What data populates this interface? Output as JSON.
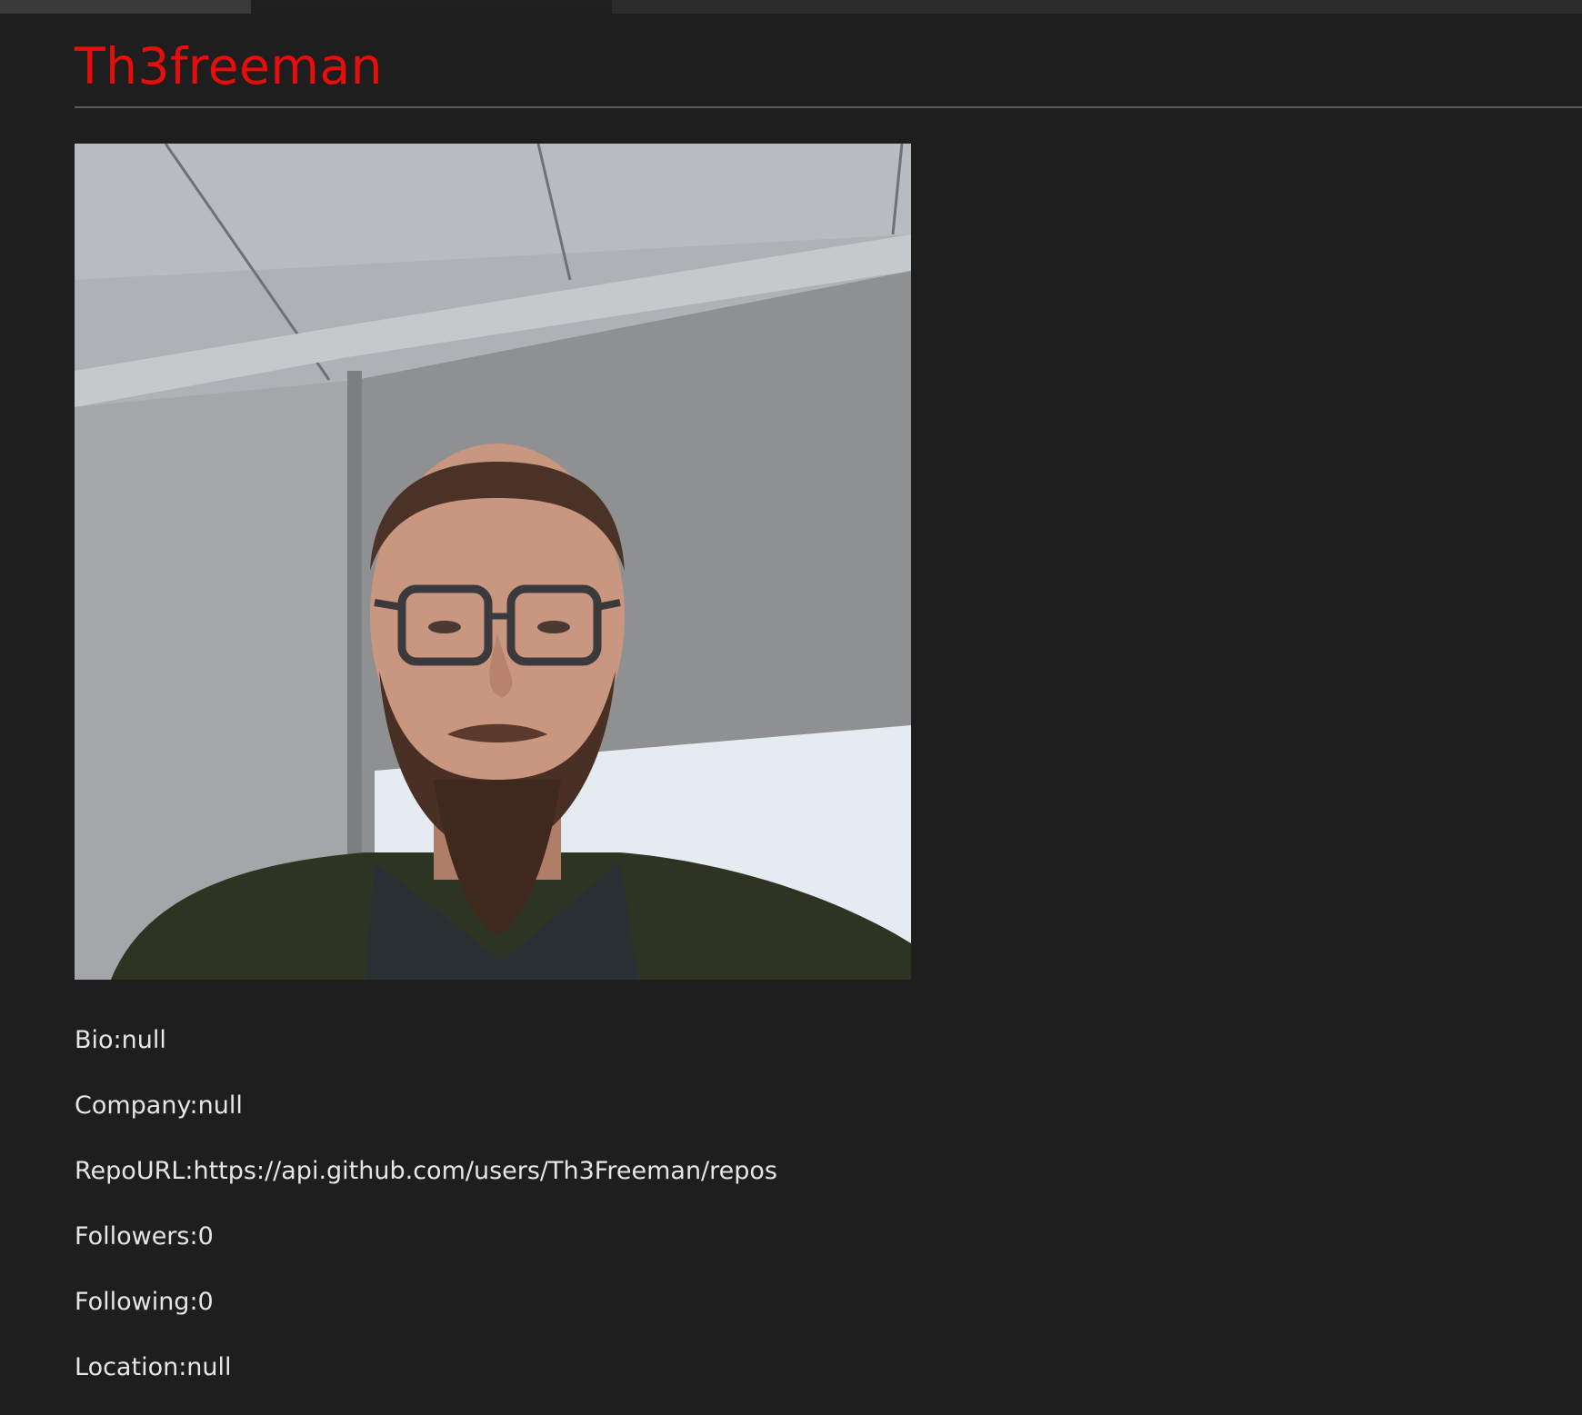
{
  "profile": {
    "username": "Th3freeman",
    "avatar_icon": "profile-photo",
    "fields": [
      {
        "label": "Bio:",
        "value": "null"
      },
      {
        "label": "Company:",
        "value": "null"
      },
      {
        "label": "RepoURL:",
        "value": "https://api.github.com/users/Th3Freeman/repos"
      },
      {
        "label": "Followers:",
        "value": "0"
      },
      {
        "label": "Following:",
        "value": "0"
      },
      {
        "label": "Location:",
        "value": "null"
      }
    ]
  },
  "colors": {
    "background": "#1e1e1e",
    "username": "#e60d0d",
    "text": "#e6e6e6",
    "divider": "#5a5a5a"
  }
}
